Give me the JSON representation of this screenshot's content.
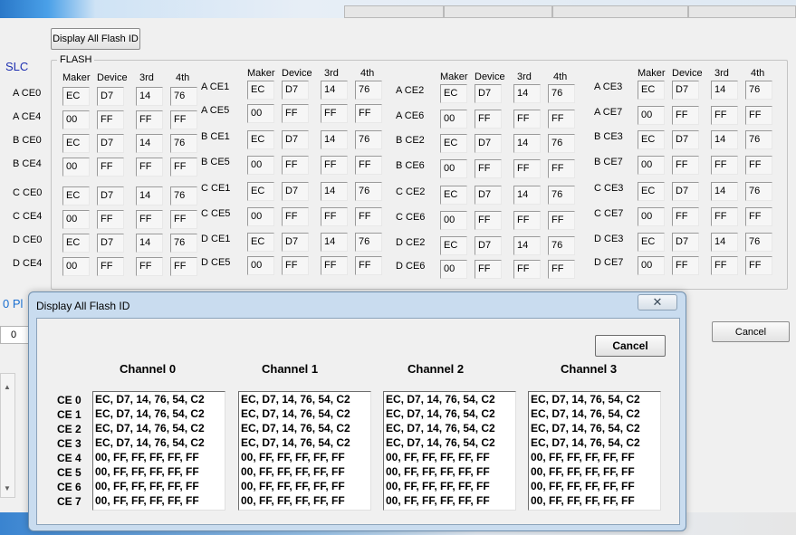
{
  "toolbar": {
    "display_all_flash_id_label": "Display All Flash ID"
  },
  "slc_label": "SLC",
  "flash_group_label": "FLASH",
  "column_headers": [
    "Maker",
    "Device",
    "3rd",
    "4th"
  ],
  "groups": [
    {
      "labels": [
        "A CE0",
        "A CE4",
        "B CE0",
        "B CE4",
        "C CE0",
        "C CE4",
        "D CE0",
        "D CE4"
      ],
      "rows": [
        [
          "EC",
          "D7",
          "14",
          "76"
        ],
        [
          "00",
          "FF",
          "FF",
          "FF"
        ],
        [
          "EC",
          "D7",
          "14",
          "76"
        ],
        [
          "00",
          "FF",
          "FF",
          "FF"
        ],
        [
          "EC",
          "D7",
          "14",
          "76"
        ],
        [
          "00",
          "FF",
          "FF",
          "FF"
        ],
        [
          "EC",
          "D7",
          "14",
          "76"
        ],
        [
          "00",
          "FF",
          "FF",
          "FF"
        ]
      ]
    },
    {
      "labels": [
        "A CE1",
        "A CE5",
        "B CE1",
        "B CE5",
        "C CE1",
        "C CE5",
        "D CE1",
        "D CE5"
      ],
      "rows": [
        [
          "EC",
          "D7",
          "14",
          "76"
        ],
        [
          "00",
          "FF",
          "FF",
          "FF"
        ],
        [
          "EC",
          "D7",
          "14",
          "76"
        ],
        [
          "00",
          "FF",
          "FF",
          "FF"
        ],
        [
          "EC",
          "D7",
          "14",
          "76"
        ],
        [
          "00",
          "FF",
          "FF",
          "FF"
        ],
        [
          "EC",
          "D7",
          "14",
          "76"
        ],
        [
          "00",
          "FF",
          "FF",
          "FF"
        ]
      ]
    },
    {
      "labels": [
        "A CE2",
        "A CE6",
        "B CE2",
        "B CE6",
        "C CE2",
        "C CE6",
        "D CE2",
        "D CE6"
      ],
      "rows": [
        [
          "EC",
          "D7",
          "14",
          "76"
        ],
        [
          "00",
          "FF",
          "FF",
          "FF"
        ],
        [
          "EC",
          "D7",
          "14",
          "76"
        ],
        [
          "00",
          "FF",
          "FF",
          "FF"
        ],
        [
          "EC",
          "D7",
          "14",
          "76"
        ],
        [
          "00",
          "FF",
          "FF",
          "FF"
        ],
        [
          "EC",
          "D7",
          "14",
          "76"
        ],
        [
          "00",
          "FF",
          "FF",
          "FF"
        ]
      ]
    },
    {
      "labels": [
        "A CE3",
        "A CE7",
        "B CE3",
        "B CE7",
        "C CE3",
        "C CE7",
        "D CE3",
        "D CE7"
      ],
      "rows": [
        [
          "EC",
          "D7",
          "14",
          "76"
        ],
        [
          "00",
          "FF",
          "FF",
          "FF"
        ],
        [
          "EC",
          "D7",
          "14",
          "76"
        ],
        [
          "00",
          "FF",
          "FF",
          "FF"
        ],
        [
          "EC",
          "D7",
          "14",
          "76"
        ],
        [
          "00",
          "FF",
          "FF",
          "FF"
        ],
        [
          "EC",
          "D7",
          "14",
          "76"
        ],
        [
          "00",
          "FF",
          "FF",
          "FF"
        ]
      ]
    }
  ],
  "left_panel": {
    "partial_label": "0 Pl",
    "value": "0"
  },
  "main_cancel_label": "Cancel",
  "dialog": {
    "title": "Display All Flash ID",
    "close_glyph": "✕",
    "cancel_label": "Cancel",
    "channel_headers": [
      "Channel 0",
      "Channel 1",
      "Channel 2",
      "Channel 3"
    ],
    "ce_labels": [
      "CE 0",
      "CE 1",
      "CE 2",
      "CE 3",
      "CE 4",
      "CE 5",
      "CE 6",
      "CE 7"
    ],
    "channels": [
      [
        "EC, D7, 14, 76, 54, C2",
        "EC, D7, 14, 76, 54, C2",
        "EC, D7, 14, 76, 54, C2",
        "EC, D7, 14, 76, 54, C2",
        "00, FF, FF, FF, FF, FF",
        "00, FF, FF, FF, FF, FF",
        "00, FF, FF, FF, FF, FF",
        "00, FF, FF, FF, FF, FF"
      ],
      [
        "EC, D7, 14, 76, 54, C2",
        "EC, D7, 14, 76, 54, C2",
        "EC, D7, 14, 76, 54, C2",
        "EC, D7, 14, 76, 54, C2",
        "00, FF, FF, FF, FF, FF",
        "00, FF, FF, FF, FF, FF",
        "00, FF, FF, FF, FF, FF",
        "00, FF, FF, FF, FF, FF"
      ],
      [
        "EC, D7, 14, 76, 54, C2",
        "EC, D7, 14, 76, 54, C2",
        "EC, D7, 14, 76, 54, C2",
        "EC, D7, 14, 76, 54, C2",
        "00, FF, FF, FF, FF, FF",
        "00, FF, FF, FF, FF, FF",
        "00, FF, FF, FF, FF, FF",
        "00, FF, FF, FF, FF, FF"
      ],
      [
        "EC, D7, 14, 76, 54, C2",
        "EC, D7, 14, 76, 54, C2",
        "EC, D7, 14, 76, 54, C2",
        "EC, D7, 14, 76, 54, C2",
        "00, FF, FF, FF, FF, FF",
        "00, FF, FF, FF, FF, FF",
        "00, FF, FF, FF, FF, FF",
        "00, FF, FF, FF, FF, FF"
      ]
    ]
  },
  "colors": {
    "slc_label": "#1e2fb0",
    "dialog_frame": "#c9dcef",
    "window_bg": "#f0f0f0"
  }
}
